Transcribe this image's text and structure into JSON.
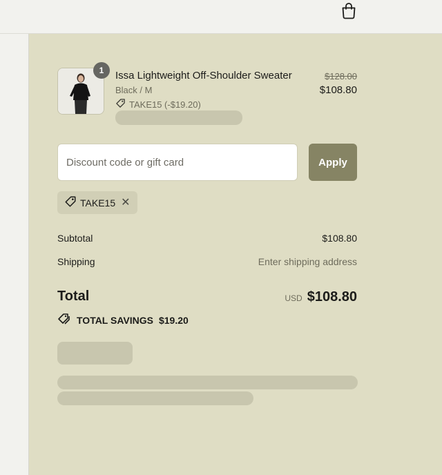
{
  "header": {
    "bag_icon": "shopping-bag-icon"
  },
  "line_item": {
    "quantity": "1",
    "title": "Issa Lightweight Off-Shoulder Sweater",
    "variant": "Black / M",
    "discount": "TAKE15 (-$19.20)",
    "original_price": "$128.00",
    "price": "$108.80",
    "image_icon": "product-photo"
  },
  "discount": {
    "placeholder": "Discount code or gift card",
    "value": "",
    "apply_label": "Apply",
    "applied_code": "TAKE15"
  },
  "summary": {
    "subtotal_label": "Subtotal",
    "subtotal_value": "$108.80",
    "shipping_label": "Shipping",
    "shipping_value": "Enter shipping address",
    "total_label": "Total",
    "currency": "USD",
    "total_value": "$108.80",
    "savings_label": "TOTAL SAVINGS",
    "savings_value": "$19.20"
  },
  "colors": {
    "summary_background": "#dfddc4",
    "apply_button": "#868464",
    "chip_background": "#d1cfb6",
    "skeleton": "#c8c6ae"
  }
}
